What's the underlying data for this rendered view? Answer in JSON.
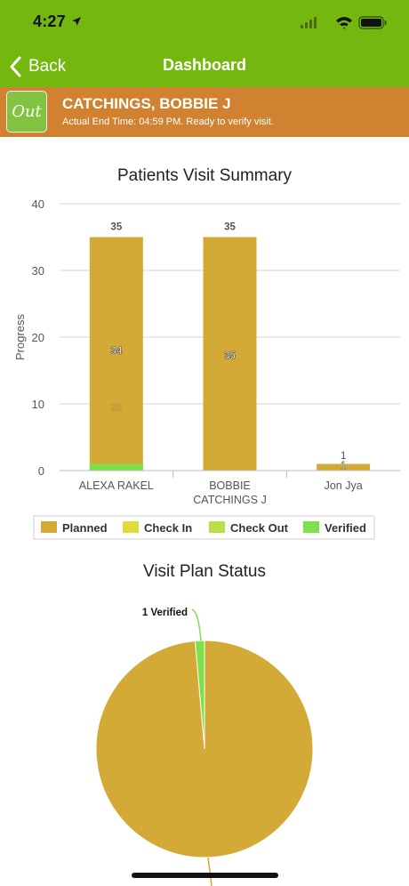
{
  "status_bar": {
    "time": "4:27"
  },
  "nav": {
    "back_label": "Back",
    "title": "Dashboard"
  },
  "visit": {
    "badge": "Out",
    "patient_name": "CATCHINGS, BOBBIE J",
    "status": "Actual End Time: 04:59 PM. Ready to verify visit."
  },
  "colors": {
    "nav_green": "#74b80f",
    "banner_orange": "#d08230",
    "planned": "#d4aa37",
    "check_in": "#dedc3a",
    "check_out": "#b4e04a",
    "verified": "#7ee04a"
  },
  "chart_data": [
    {
      "type": "bar",
      "title": "Patients Visit Summary",
      "ylabel": "Progress",
      "ylim": [
        0,
        40
      ],
      "yticks": [
        0,
        10,
        20,
        30,
        40
      ],
      "grid": true,
      "stacked": true,
      "legend_position": "bottom",
      "categories": [
        "ALEXA RAKEL",
        "BOBBIE CATCHINGS J",
        "Jon Jya"
      ],
      "category_lines": [
        [
          "ALEXA RAKEL"
        ],
        [
          "BOBBIE",
          "CATCHINGS J"
        ],
        [
          "Jon Jya"
        ]
      ],
      "series": [
        {
          "name": "Planned",
          "values": [
            35,
            35,
            1
          ]
        },
        {
          "name": "Check In",
          "values": [
            0,
            0,
            0
          ]
        },
        {
          "name": "Check Out",
          "values": [
            0,
            0,
            0
          ]
        },
        {
          "name": "Verified",
          "values": [
            1,
            0,
            0
          ]
        }
      ],
      "data_labels": [
        {
          "category": 0,
          "text": "35",
          "value": 35,
          "style": "top"
        },
        {
          "category": 0,
          "text": "34",
          "value": 18,
          "style": "inside"
        },
        {
          "category": 0,
          "text": "35",
          "value": 9.5,
          "style": "faint"
        },
        {
          "category": 1,
          "text": "35",
          "value": 35,
          "style": "top"
        },
        {
          "category": 1,
          "text": "35",
          "value": 17.3,
          "style": "inside"
        },
        {
          "category": 2,
          "text": "1",
          "value": 2.3,
          "style": "top-small"
        },
        {
          "category": 2,
          "text": "1",
          "value": 0.8,
          "style": "inside-small"
        }
      ]
    },
    {
      "type": "pie",
      "title": "Visit Plan Status",
      "slices": [
        {
          "name": "Planned",
          "value": 71
        },
        {
          "name": "Verified",
          "value": 1,
          "label": "1 Verified"
        }
      ]
    }
  ]
}
